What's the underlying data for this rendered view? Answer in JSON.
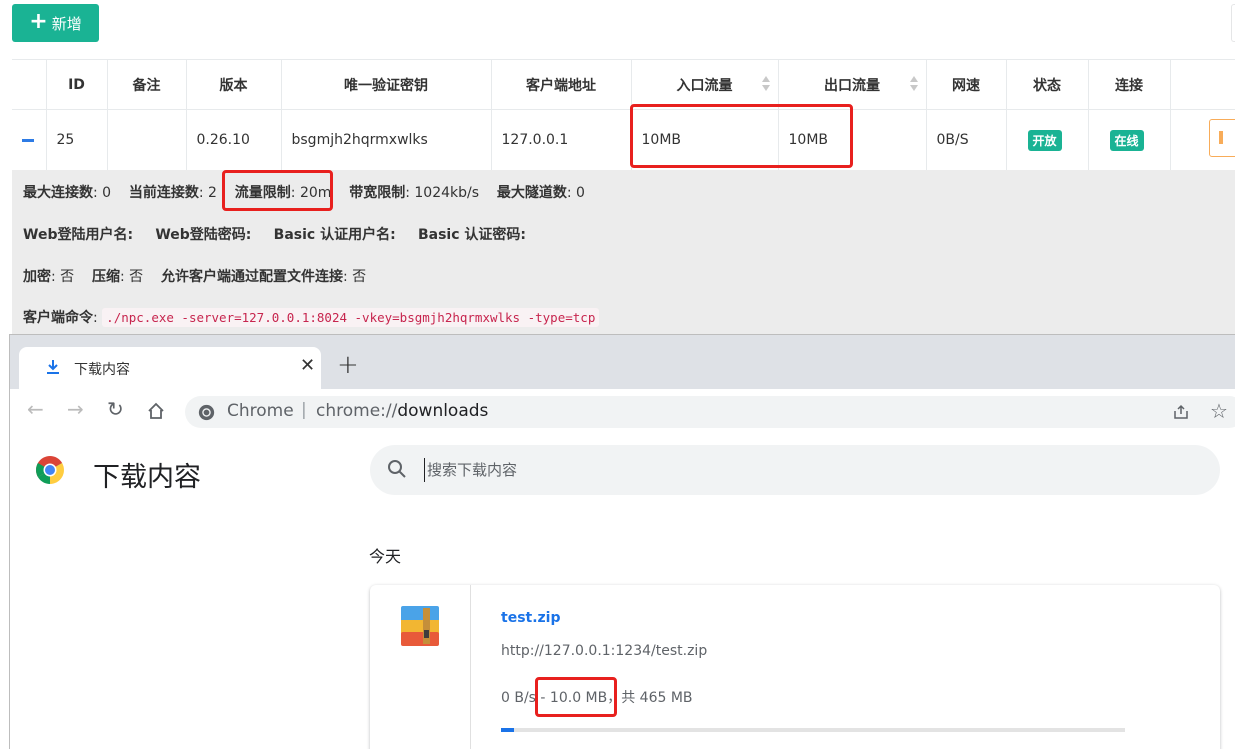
{
  "nps": {
    "add_button": "新增",
    "columns": [
      "",
      "ID",
      "备注",
      "版本",
      "唯一验证密钥",
      "客户端地址",
      "入口流量",
      "出口流量",
      "网速",
      "状态",
      "连接"
    ],
    "row": {
      "id": "25",
      "remark": "",
      "version": "0.26.10",
      "vkey": "bsgmjh2hqrmxwlks",
      "client_addr": "127.0.0.1",
      "in_flow": "10MB",
      "out_flow": "10MB",
      "speed": "0B/S",
      "status": "开放",
      "connection": "在线"
    },
    "detail": {
      "max_conn_label": "最大连接数",
      "max_conn": ": 0",
      "cur_conn_label": "当前连接数",
      "cur_conn": ": 2",
      "flow_limit_label": "流量限制",
      "flow_limit": ": 20m",
      "rate_limit_label": "带宽限制",
      "rate_limit": ": 1024kb/s",
      "max_tunnel_label": "最大隧道数",
      "max_tunnel": ": 0",
      "web_user_label": "Web登陆用户名:",
      "web_pass_label": "Web登陆密码:",
      "basic_user_label": "Basic 认证用户名:",
      "basic_pass_label": "Basic 认证密码:",
      "crypt_label": "加密",
      "crypt": ": 否",
      "compress_label": "压缩",
      "compress": ": 否",
      "config_conn_label": "允许客户端通过配置文件连接",
      "config_conn": ": 否",
      "cmd_label": "客户端命令",
      "cmd_colon": ":",
      "cmd": "./npc.exe -server=127.0.0.1:8024 -vkey=bsgmjh2hqrmxwlks -type=tcp"
    }
  },
  "chrome": {
    "tab_title": "下载内容",
    "omnibox_site": "Chrome",
    "omnibox_url_scheme": "chrome://",
    "omnibox_url_host": "downloads",
    "page_title": "下载内容",
    "search_placeholder": "搜索下载内容",
    "date_label": "今天",
    "download": {
      "file_name": "test.zip",
      "url": "http://127.0.0.1:1234/test.zip",
      "status": "0 B/s - 10.0 MB，共 465 MB",
      "progress_fraction": 0.0215
    }
  },
  "colors": {
    "accent_green": "#1ab394",
    "highlight_red": "#e8201e",
    "chrome_blue": "#1a73e8",
    "warning_orange": "#f8ac59"
  }
}
